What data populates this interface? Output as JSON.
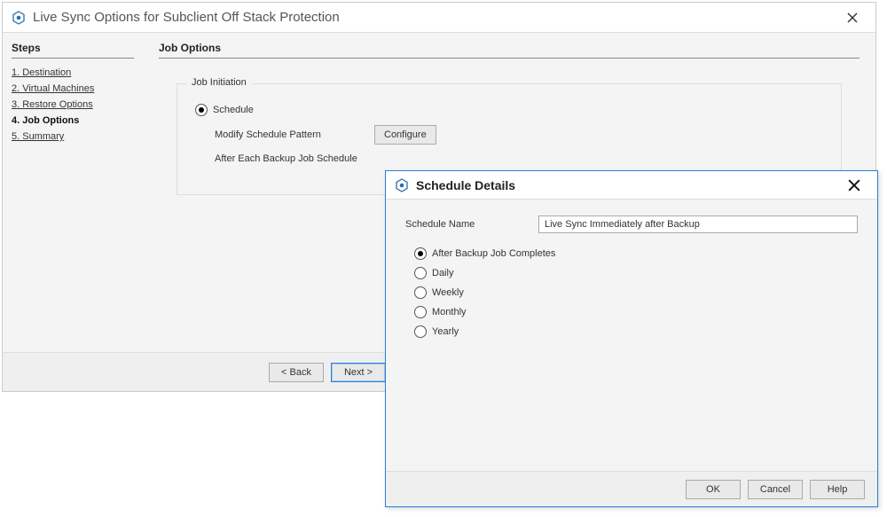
{
  "wizard": {
    "title": "Live Sync Options for Subclient Off Stack Protection",
    "steps_header": "Steps",
    "steps": [
      {
        "label": "1. Destination",
        "current": false
      },
      {
        "label": "2. Virtual Machines",
        "current": false
      },
      {
        "label": "3. Restore Options",
        "current": false
      },
      {
        "label": "4. Job Options",
        "current": true
      },
      {
        "label": "5. Summary",
        "current": false
      }
    ],
    "content_header": "Job Options",
    "job_initiation_legend": "Job Initiation",
    "schedule_radio_label": "Schedule",
    "modify_pattern_label": "Modify Schedule Pattern",
    "configure_btn": "Configure",
    "after_each_label": "After Each Backup Job Schedule",
    "back_btn": "< Back",
    "next_btn": "Next >"
  },
  "dialog": {
    "title": "Schedule Details",
    "name_label": "Schedule Name",
    "name_value": "Live Sync Immediately after Backup",
    "freq_options": [
      {
        "label": "After Backup Job Completes",
        "selected": true
      },
      {
        "label": "Daily",
        "selected": false
      },
      {
        "label": "Weekly",
        "selected": false
      },
      {
        "label": "Monthly",
        "selected": false
      },
      {
        "label": "Yearly",
        "selected": false
      }
    ],
    "ok_btn": "OK",
    "cancel_btn": "Cancel",
    "help_btn": "Help"
  }
}
